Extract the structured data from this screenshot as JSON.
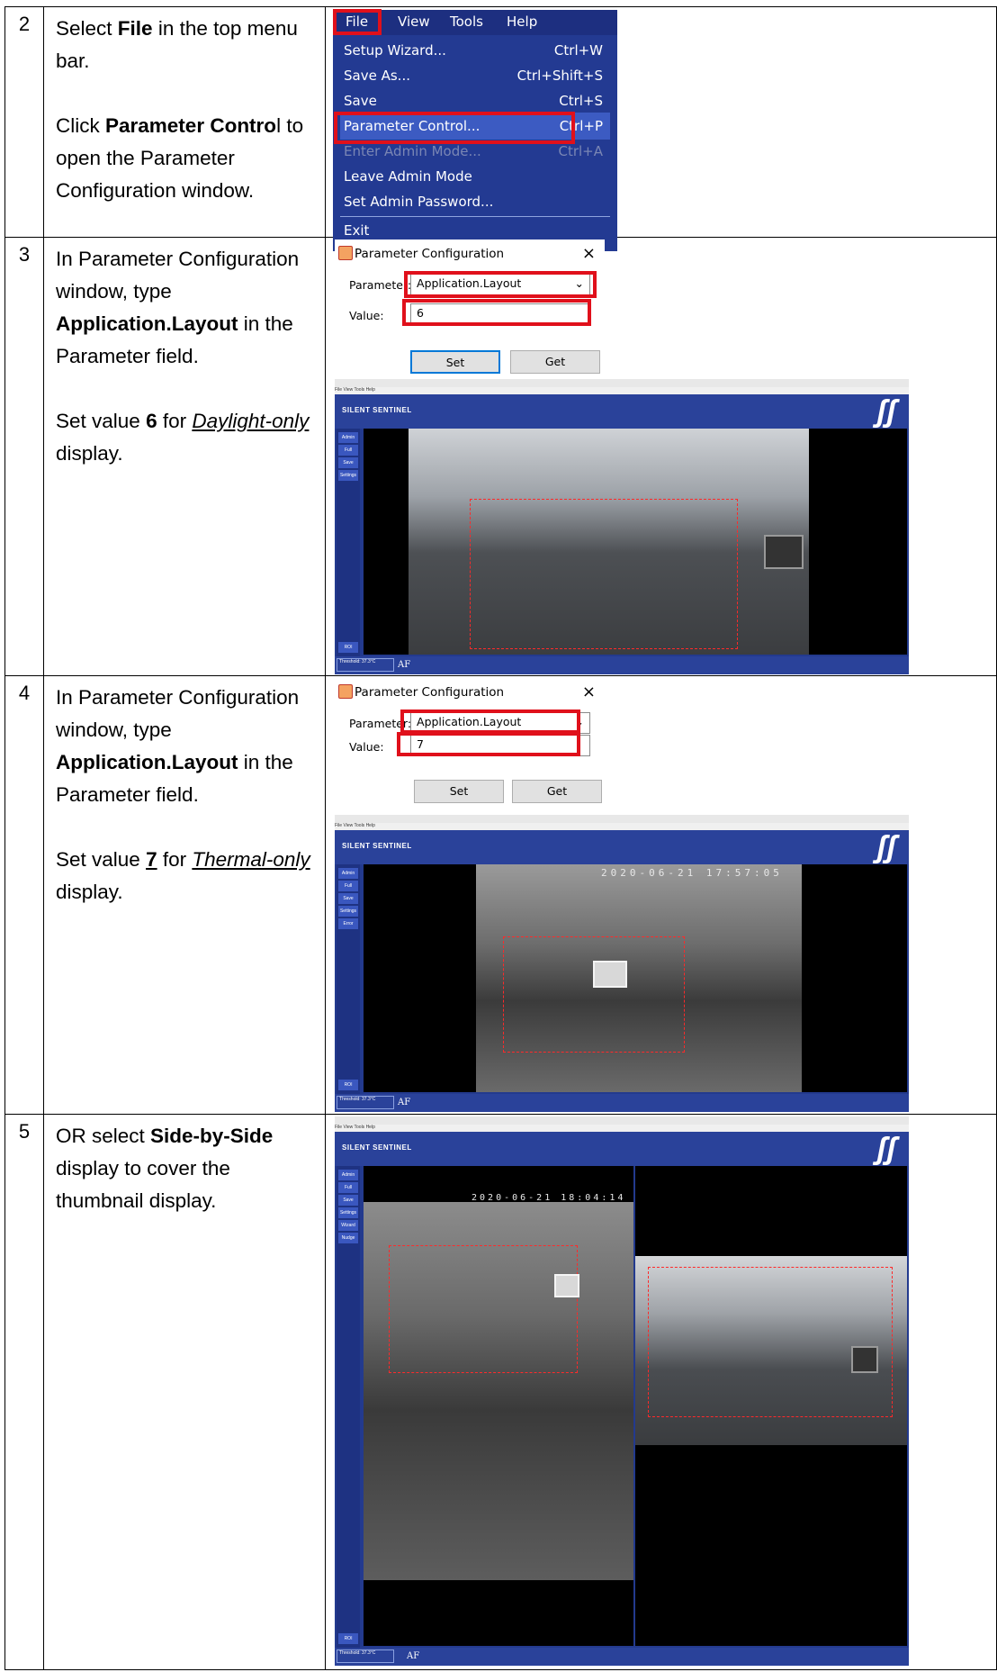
{
  "steps": [
    {
      "num": "2",
      "paragraphs": [
        [
          {
            "t": "Select "
          },
          {
            "t": "File",
            "b": true
          },
          {
            "t": " in the top menu bar."
          }
        ],
        [
          {
            "t": "Click "
          },
          {
            "t": "Parameter Contro",
            "b": true
          },
          {
            "t": "l to open the Parameter Configuration window."
          }
        ]
      ]
    },
    {
      "num": "3",
      "paragraphs": [
        [
          {
            "t": "In Parameter Configuration window, type "
          },
          {
            "t": "Application.Layout",
            "b": true
          },
          {
            "t": " in the Parameter field."
          }
        ],
        [
          {
            "t": "Set value "
          },
          {
            "t": "6",
            "b": true
          },
          {
            "t": " for "
          },
          {
            "t": "Daylight-only",
            "i": true,
            "u": true
          },
          {
            "t": " display."
          }
        ]
      ]
    },
    {
      "num": "4",
      "paragraphs": [
        [
          {
            "t": "In Parameter Configuration window, type "
          },
          {
            "t": "Application.Layout",
            "b": true
          },
          {
            "t": " in the Parameter field."
          }
        ],
        [
          {
            "t": "Set value "
          },
          {
            "t": "7",
            "b": true,
            "u": true
          },
          {
            "t": " for "
          },
          {
            "t": "Thermal-only",
            "i": true,
            "u": true
          },
          {
            "t": " display."
          }
        ]
      ]
    },
    {
      "num": "5",
      "paragraphs": [
        [
          {
            "t": "OR select "
          },
          {
            "t": "Side-by-Side",
            "b": true
          },
          {
            "t": " display to cover the thumbnail display."
          }
        ]
      ]
    }
  ],
  "menu": {
    "bar": [
      "File",
      "View",
      "Tools",
      "Help"
    ],
    "items": [
      {
        "label": "Setup Wizard...",
        "key": "Ctrl+W"
      },
      {
        "label": "Save As...",
        "key": "Ctrl+Shift+S"
      },
      {
        "label": "Save",
        "key": "Ctrl+S"
      },
      {
        "label": "Parameter Control...",
        "key": "Ctrl+P",
        "highlight": true
      },
      {
        "label": "Enter Admin Mode...",
        "key": "Ctrl+A",
        "disabled": true
      },
      {
        "label": "Leave Admin Mode",
        "key": ""
      },
      {
        "label": "Set Admin Password...",
        "key": ""
      },
      {
        "label": "Exit",
        "key": ""
      }
    ]
  },
  "dialog": {
    "title": "Parameter Configuration",
    "close": "×",
    "parameter_label": "Parameter:",
    "value_label": "Value:",
    "parameter_value": "Application.Layout",
    "set_label": "Set",
    "get_label": "Get",
    "step3_value": "6",
    "step4_value": "7"
  },
  "app": {
    "brand": "SILENT SENTINEL",
    "logo": "ʃʃ",
    "menu": "File  View  Tools  Help",
    "side_buttons_a": [
      "Admin",
      "Full",
      "Save",
      "Settings"
    ],
    "side_buttons_b": [
      "Admin",
      "Full",
      "Save",
      "Settings",
      "Error"
    ],
    "side_buttons_c": [
      "Admin",
      "Full",
      "Save",
      "Settings",
      "Wizard",
      "Nudge"
    ],
    "roi_label": "ROI",
    "threshold": "Threshold: 37.3°C",
    "af": "AF",
    "timestamp_4": "2020-06-21 17:57:05",
    "timestamp_5": "2020-06-21 18:04:14"
  }
}
